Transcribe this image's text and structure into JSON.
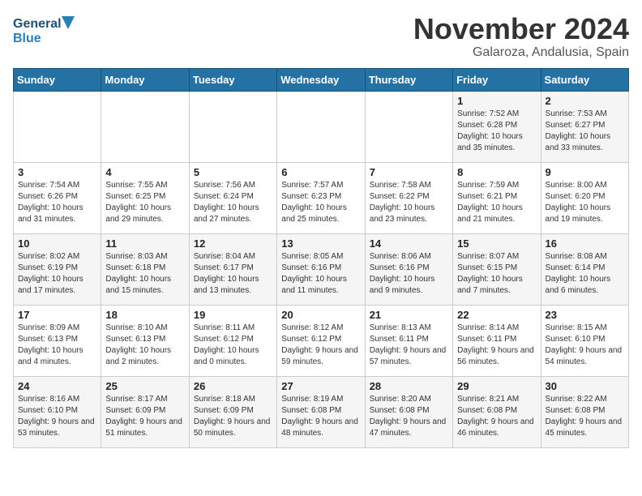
{
  "logo": {
    "line1": "General",
    "line2": "Blue"
  },
  "title": "November 2024",
  "subtitle": "Galaroza, Andalusia, Spain",
  "days_of_week": [
    "Sunday",
    "Monday",
    "Tuesday",
    "Wednesday",
    "Thursday",
    "Friday",
    "Saturday"
  ],
  "weeks": [
    [
      {
        "day": "",
        "info": ""
      },
      {
        "day": "",
        "info": ""
      },
      {
        "day": "",
        "info": ""
      },
      {
        "day": "",
        "info": ""
      },
      {
        "day": "",
        "info": ""
      },
      {
        "day": "1",
        "info": "Sunrise: 7:52 AM\nSunset: 6:28 PM\nDaylight: 10 hours and 35 minutes."
      },
      {
        "day": "2",
        "info": "Sunrise: 7:53 AM\nSunset: 6:27 PM\nDaylight: 10 hours and 33 minutes."
      }
    ],
    [
      {
        "day": "3",
        "info": "Sunrise: 7:54 AM\nSunset: 6:26 PM\nDaylight: 10 hours and 31 minutes."
      },
      {
        "day": "4",
        "info": "Sunrise: 7:55 AM\nSunset: 6:25 PM\nDaylight: 10 hours and 29 minutes."
      },
      {
        "day": "5",
        "info": "Sunrise: 7:56 AM\nSunset: 6:24 PM\nDaylight: 10 hours and 27 minutes."
      },
      {
        "day": "6",
        "info": "Sunrise: 7:57 AM\nSunset: 6:23 PM\nDaylight: 10 hours and 25 minutes."
      },
      {
        "day": "7",
        "info": "Sunrise: 7:58 AM\nSunset: 6:22 PM\nDaylight: 10 hours and 23 minutes."
      },
      {
        "day": "8",
        "info": "Sunrise: 7:59 AM\nSunset: 6:21 PM\nDaylight: 10 hours and 21 minutes."
      },
      {
        "day": "9",
        "info": "Sunrise: 8:00 AM\nSunset: 6:20 PM\nDaylight: 10 hours and 19 minutes."
      }
    ],
    [
      {
        "day": "10",
        "info": "Sunrise: 8:02 AM\nSunset: 6:19 PM\nDaylight: 10 hours and 17 minutes."
      },
      {
        "day": "11",
        "info": "Sunrise: 8:03 AM\nSunset: 6:18 PM\nDaylight: 10 hours and 15 minutes."
      },
      {
        "day": "12",
        "info": "Sunrise: 8:04 AM\nSunset: 6:17 PM\nDaylight: 10 hours and 13 minutes."
      },
      {
        "day": "13",
        "info": "Sunrise: 8:05 AM\nSunset: 6:16 PM\nDaylight: 10 hours and 11 minutes."
      },
      {
        "day": "14",
        "info": "Sunrise: 8:06 AM\nSunset: 6:16 PM\nDaylight: 10 hours and 9 minutes."
      },
      {
        "day": "15",
        "info": "Sunrise: 8:07 AM\nSunset: 6:15 PM\nDaylight: 10 hours and 7 minutes."
      },
      {
        "day": "16",
        "info": "Sunrise: 8:08 AM\nSunset: 6:14 PM\nDaylight: 10 hours and 6 minutes."
      }
    ],
    [
      {
        "day": "17",
        "info": "Sunrise: 8:09 AM\nSunset: 6:13 PM\nDaylight: 10 hours and 4 minutes."
      },
      {
        "day": "18",
        "info": "Sunrise: 8:10 AM\nSunset: 6:13 PM\nDaylight: 10 hours and 2 minutes."
      },
      {
        "day": "19",
        "info": "Sunrise: 8:11 AM\nSunset: 6:12 PM\nDaylight: 10 hours and 0 minutes."
      },
      {
        "day": "20",
        "info": "Sunrise: 8:12 AM\nSunset: 6:12 PM\nDaylight: 9 hours and 59 minutes."
      },
      {
        "day": "21",
        "info": "Sunrise: 8:13 AM\nSunset: 6:11 PM\nDaylight: 9 hours and 57 minutes."
      },
      {
        "day": "22",
        "info": "Sunrise: 8:14 AM\nSunset: 6:11 PM\nDaylight: 9 hours and 56 minutes."
      },
      {
        "day": "23",
        "info": "Sunrise: 8:15 AM\nSunset: 6:10 PM\nDaylight: 9 hours and 54 minutes."
      }
    ],
    [
      {
        "day": "24",
        "info": "Sunrise: 8:16 AM\nSunset: 6:10 PM\nDaylight: 9 hours and 53 minutes."
      },
      {
        "day": "25",
        "info": "Sunrise: 8:17 AM\nSunset: 6:09 PM\nDaylight: 9 hours and 51 minutes."
      },
      {
        "day": "26",
        "info": "Sunrise: 8:18 AM\nSunset: 6:09 PM\nDaylight: 9 hours and 50 minutes."
      },
      {
        "day": "27",
        "info": "Sunrise: 8:19 AM\nSunset: 6:08 PM\nDaylight: 9 hours and 48 minutes."
      },
      {
        "day": "28",
        "info": "Sunrise: 8:20 AM\nSunset: 6:08 PM\nDaylight: 9 hours and 47 minutes."
      },
      {
        "day": "29",
        "info": "Sunrise: 8:21 AM\nSunset: 6:08 PM\nDaylight: 9 hours and 46 minutes."
      },
      {
        "day": "30",
        "info": "Sunrise: 8:22 AM\nSunset: 6:08 PM\nDaylight: 9 hours and 45 minutes."
      }
    ]
  ]
}
